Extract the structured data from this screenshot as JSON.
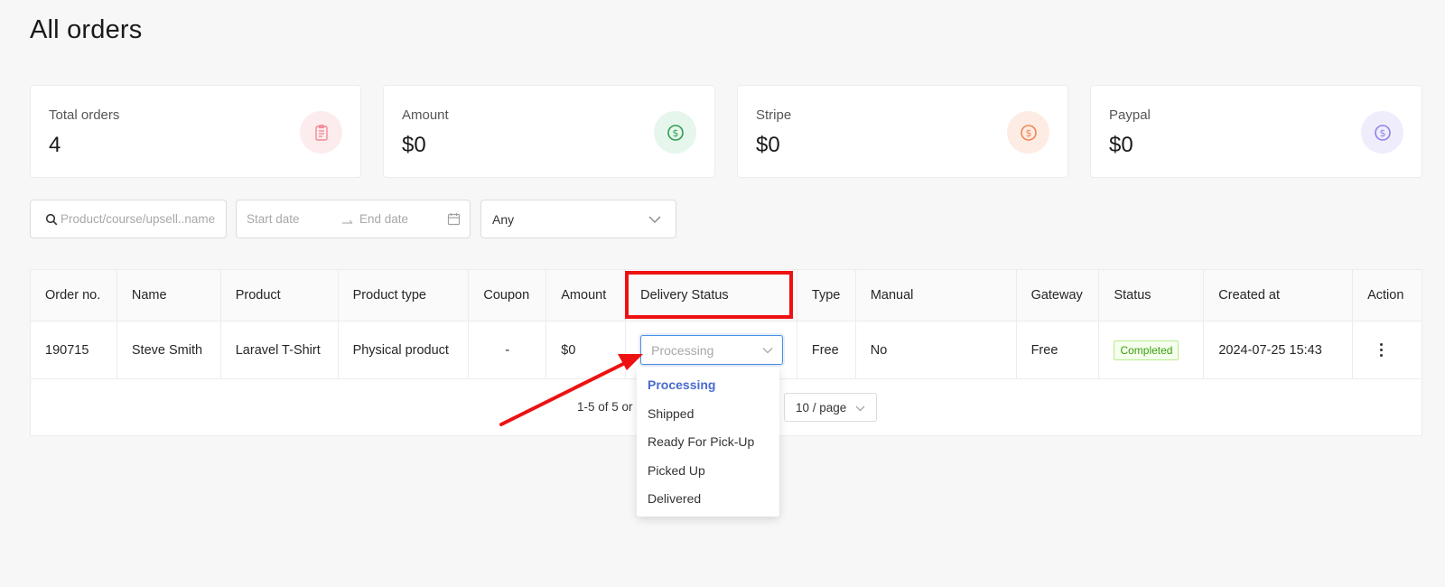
{
  "page": {
    "title": "All orders"
  },
  "stats": [
    {
      "label": "Total orders",
      "value": "4",
      "icon": "clipboard-icon",
      "icon_color": "#f28a95",
      "icon_bg": "#fdecee"
    },
    {
      "label": "Amount",
      "value": "$0",
      "icon": "dollar-icon",
      "icon_color": "#2e9e4f",
      "icon_bg": "#e6f6ec"
    },
    {
      "label": "Stripe",
      "value": "$0",
      "icon": "dollar-icon",
      "icon_color": "#f28454",
      "icon_bg": "#fdece4"
    },
    {
      "label": "Paypal",
      "value": "$0",
      "icon": "dollar-icon",
      "icon_color": "#8f83e8",
      "icon_bg": "#efedfc"
    }
  ],
  "filters": {
    "search_placeholder": "Product/course/upsell..name",
    "start_date_placeholder": "Start date",
    "end_date_placeholder": "End date",
    "status_select_value": "Any"
  },
  "table": {
    "columns": [
      "Order no.",
      "Name",
      "Product",
      "Product type",
      "Coupon",
      "Amount",
      "Delivery Status",
      "Type",
      "Manual",
      "Gateway",
      "Status",
      "Created at",
      "Action"
    ],
    "rows": [
      {
        "order_no": "190715",
        "name": "Steve Smith",
        "product": "Laravel T-Shirt",
        "product_type": "Physical product",
        "coupon": "-",
        "amount": "$0",
        "delivery_status": "Processing",
        "type": "Free",
        "manual": "No",
        "gateway": "Free",
        "status": "Completed",
        "created_at": "2024-07-25 15:43"
      }
    ]
  },
  "pagination": {
    "range_text": "1-5 of 5 or",
    "page_size": "10 / page"
  },
  "delivery_dropdown": {
    "options": [
      "Processing",
      "Shipped",
      "Ready For Pick-Up",
      "Picked Up",
      "Delivered"
    ],
    "selected": "Processing"
  },
  "colors": {
    "accent": "#4a6ad0",
    "annotation": "#ee1111",
    "success": "#389e0d"
  }
}
